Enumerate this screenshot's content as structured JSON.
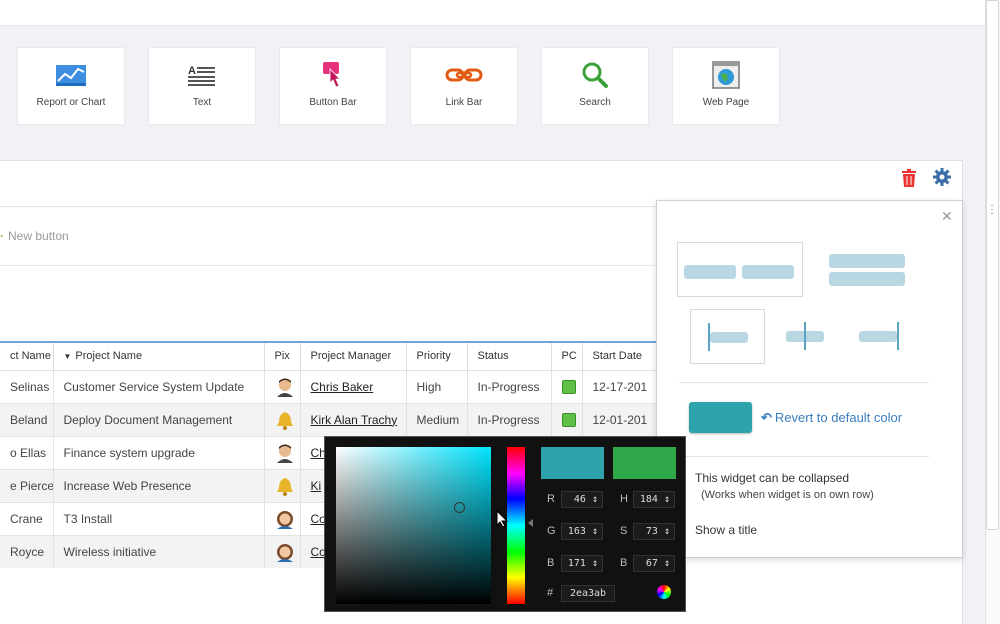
{
  "widgets": [
    {
      "label": "Report or Chart",
      "icon": "chart-icon"
    },
    {
      "label": "Text",
      "icon": "text-icon"
    },
    {
      "label": "Button Bar",
      "icon": "button-bar-icon"
    },
    {
      "label": "Link Bar",
      "icon": "link-icon"
    },
    {
      "label": "Search",
      "icon": "search-icon"
    },
    {
      "label": "Web Page",
      "icon": "web-page-icon"
    }
  ],
  "toolbar": {
    "new_button": "New button"
  },
  "table": {
    "headers": [
      "ct Name",
      "Project Name",
      "Pix",
      "Project Manager",
      "Priority",
      "Status",
      "PC",
      "Start Date"
    ],
    "rows": [
      [
        "Selinas",
        "Customer Service System Update",
        "",
        "Chris Baker",
        "High",
        "In-Progress",
        "",
        "12-17-201"
      ],
      [
        "Beland",
        "Deploy Document Management",
        "",
        "Kirk Alan Trachy",
        "Medium",
        "In-Progress",
        "",
        "12-01-201"
      ],
      [
        "o Ellas",
        "Finance system upgrade",
        "",
        "Ch",
        "",
        "",
        "",
        ""
      ],
      [
        "e Pierce",
        "Increase Web Presence",
        "",
        "Ki",
        "",
        "",
        "",
        ""
      ],
      [
        "Crane",
        "T3 Install",
        "",
        "Co",
        "",
        "",
        "",
        ""
      ],
      [
        "Royce",
        "Wireless initiative",
        "",
        "Co",
        "",
        "",
        "",
        ""
      ]
    ]
  },
  "settings": {
    "revert_label": "Revert to default color",
    "collapse_label": "This widget can be collapsed",
    "collapse_sub": "(Works when widget is on own row)",
    "show_title_label": "Show a title",
    "accent_color": "#2ea3ab"
  },
  "picker": {
    "r_label": "R",
    "r": "46",
    "g_label": "G",
    "g": "163",
    "b_label": "B",
    "b": "171",
    "h_label": "H",
    "h": "184",
    "s_label": "S",
    "s": "73",
    "v_label": "B",
    "v": "67",
    "hash": "#",
    "hex": "2ea3ab",
    "new_color": "#2ea3ab",
    "old_color": "#2fa84a"
  }
}
